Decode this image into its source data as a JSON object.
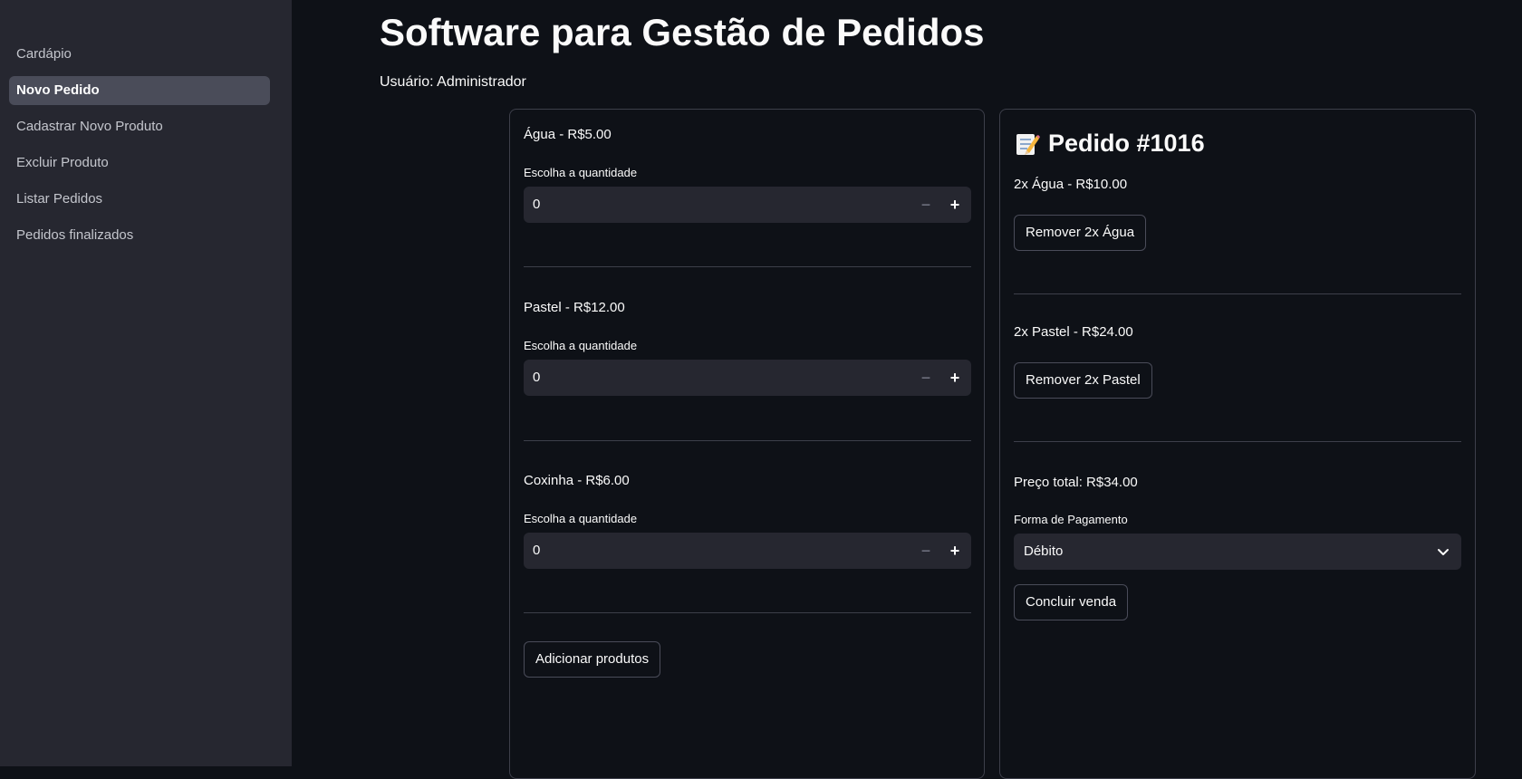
{
  "sidebar": {
    "items": [
      {
        "label": "Cardápio",
        "active": false
      },
      {
        "label": "Novo Pedido",
        "active": true
      },
      {
        "label": "Cadastrar Novo Produto",
        "active": false
      },
      {
        "label": "Excluir Produto",
        "active": false
      },
      {
        "label": "Listar Pedidos",
        "active": false
      },
      {
        "label": "Pedidos finalizados",
        "active": false
      }
    ]
  },
  "header": {
    "title": "Software para Gestão de Pedidos",
    "user": "Usuário: Administrador"
  },
  "products": [
    {
      "name": "Água - R$5.00",
      "qty_label": "Escolha a quantidade",
      "qty": "0",
      "minus": "−",
      "plus": "+"
    },
    {
      "name": "Pastel - R$12.00",
      "qty_label": "Escolha a quantidade",
      "qty": "0",
      "minus": "−",
      "plus": "+"
    },
    {
      "name": "Coxinha - R$6.00",
      "qty_label": "Escolha a quantidade",
      "qty": "0",
      "minus": "−",
      "plus": "+"
    }
  ],
  "add_button": "Adicionar produtos",
  "order": {
    "title": "Pedido #1016",
    "icon": "memo-icon",
    "lines": [
      {
        "text": "2x Água - R$10.00",
        "remove_label": "Remover 2x Água"
      },
      {
        "text": "2x Pastel - R$24.00",
        "remove_label": "Remover 2x Pastel"
      }
    ],
    "total": "Preço total: R$34.00",
    "payment_label": "Forma de Pagamento",
    "payment_value": "Débito",
    "finish_button": "Concluir venda"
  },
  "colors": {
    "background": "#0e1117",
    "sidebar": "#262730",
    "active_item": "#4a4c59",
    "text": "#fafafa"
  }
}
